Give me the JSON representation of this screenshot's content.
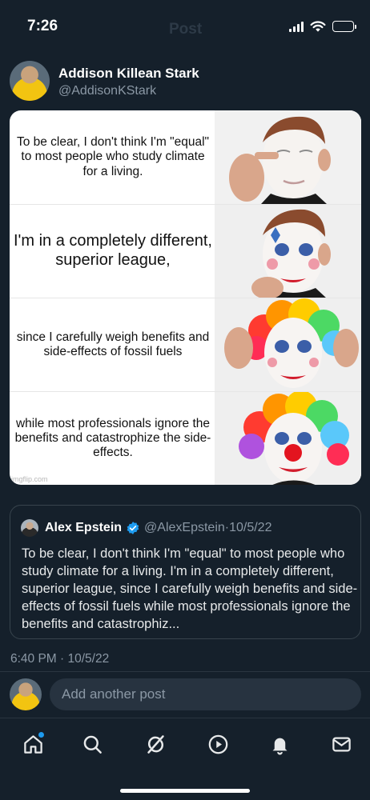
{
  "status_bar": {
    "time": "7:26",
    "faded_title": "Post"
  },
  "post": {
    "author_name": "Addison Killean Stark",
    "author_handle": "@AddisonKStark",
    "meme": {
      "panels": [
        {
          "text": "To be clear, I don't think I'm \"equal\" to most people who study climate for a living.",
          "face": "plain"
        },
        {
          "text": "I'm in a completely different, superior league,",
          "face": "painted"
        },
        {
          "text": "since I carefully weigh benefits and side-effects of fossil fuels",
          "face": "wig"
        },
        {
          "text": "while most professionals ignore the benefits and catastrophize the side-effects.",
          "face": "full-clown"
        }
      ],
      "watermark": "imgflip.com"
    },
    "quote": {
      "name": "Alex Epstein",
      "verified": true,
      "handle": "@AlexEpstein",
      "date": "10/5/22",
      "body": "To be clear, I don't think I'm \"equal\" to most people who study climate for a living. I'm in a completely different, superior league, since I carefully weigh benefits and side-effects of fossil fuels while most professionals ignore the benefits and catastrophiz..."
    },
    "timestamp": "6:40 PM · 10/5/22"
  },
  "reply": {
    "placeholder": "Add another post"
  },
  "tabs": [
    {
      "name": "home",
      "icon": "home-icon",
      "active": true
    },
    {
      "name": "search",
      "icon": "search-icon"
    },
    {
      "name": "grok",
      "icon": "grok-icon"
    },
    {
      "name": "video",
      "icon": "play-icon"
    },
    {
      "name": "notifications",
      "icon": "bell-icon"
    },
    {
      "name": "messages",
      "icon": "mail-icon"
    }
  ],
  "colors": {
    "background": "#15202b",
    "accent": "#1d9bf0",
    "muted": "#8b98a5"
  }
}
